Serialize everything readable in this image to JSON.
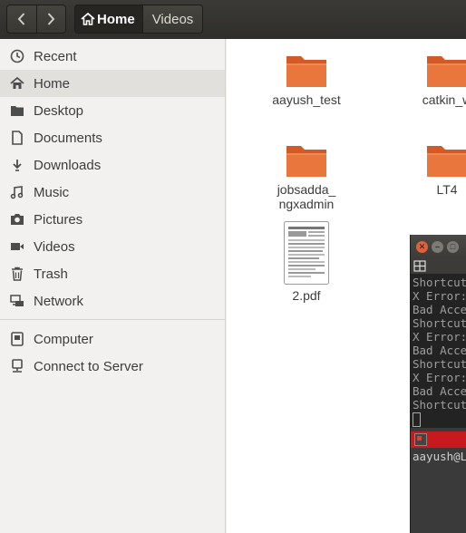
{
  "nav": {
    "back_icon": "chevron-left-icon",
    "forward_icon": "chevron-right-icon"
  },
  "pathbar": {
    "home_label": "Home",
    "videos_label": "Videos"
  },
  "sidebar": {
    "places": [
      {
        "label": "Recent",
        "icon": "clock-icon"
      },
      {
        "label": "Home",
        "icon": "home-icon",
        "selected": true
      },
      {
        "label": "Desktop",
        "icon": "folder-icon"
      },
      {
        "label": "Documents",
        "icon": "document-icon"
      },
      {
        "label": "Downloads",
        "icon": "download-icon"
      },
      {
        "label": "Music",
        "icon": "music-icon"
      },
      {
        "label": "Pictures",
        "icon": "camera-icon"
      },
      {
        "label": "Videos",
        "icon": "video-icon"
      },
      {
        "label": "Trash",
        "icon": "trash-icon"
      },
      {
        "label": "Network",
        "icon": "network-icon"
      }
    ],
    "devices": [
      {
        "label": "Computer",
        "icon": "computer-icon"
      },
      {
        "label": "Connect to Server",
        "icon": "server-icon"
      }
    ]
  },
  "files": [
    {
      "label": "aayush_test",
      "type": "folder"
    },
    {
      "label": "catkin_w",
      "type": "folder"
    },
    {
      "label": "jobsadda_ ngxadmin",
      "type": "folder"
    },
    {
      "label": "LT4",
      "type": "folder"
    },
    {
      "label": "2.pdf",
      "type": "pdf"
    }
  ],
  "terminal": {
    "lines": [
      "Shortcut",
      "X Error:",
      "Bad Acce",
      "Shortcut",
      "X Error:",
      "Bad Acce",
      "Shortcut",
      "X Error:",
      "Bad Acce",
      "Shortcut"
    ],
    "prompt": "aayush@L"
  },
  "colors": {
    "folder": "#e9763c",
    "folder_dark": "#d35a24",
    "accent_red": "#c81a1e"
  }
}
